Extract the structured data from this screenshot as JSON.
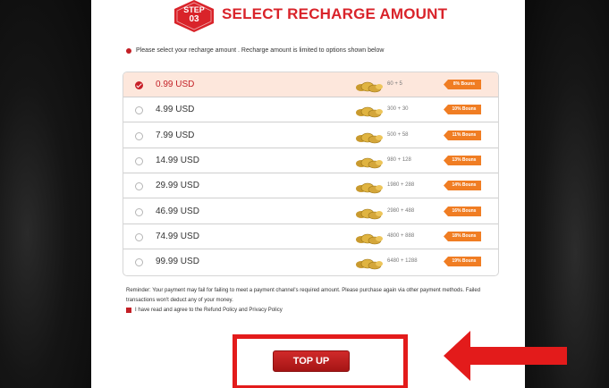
{
  "header": {
    "step_line1": "STEP",
    "step_line2": "03",
    "title": "SELECT RECHARGE AMOUNT"
  },
  "instruction": "Please select your recharge amount . Recharge amount is limited to options shown below",
  "options": [
    {
      "price": "0.99 USD",
      "amount": "60 + 5",
      "bonus": "8% Bouns",
      "selected": true
    },
    {
      "price": "4.99 USD",
      "amount": "300 + 30",
      "bonus": "10% Bouns",
      "selected": false
    },
    {
      "price": "7.99 USD",
      "amount": "500 + 58",
      "bonus": "11% Bouns",
      "selected": false
    },
    {
      "price": "14.99 USD",
      "amount": "980 + 128",
      "bonus": "13% Bouns",
      "selected": false
    },
    {
      "price": "29.99 USD",
      "amount": "1980 + 288",
      "bonus": "14% Bouns",
      "selected": false
    },
    {
      "price": "46.99 USD",
      "amount": "2980 + 488",
      "bonus": "16% Bouns",
      "selected": false
    },
    {
      "price": "74.99 USD",
      "amount": "4800 + 888",
      "bonus": "18% Bouns",
      "selected": false
    },
    {
      "price": "99.99 USD",
      "amount": "6480 + 1288",
      "bonus": "19% Bouns",
      "selected": false
    }
  ],
  "reminder": "Reminder:  Your payment may fail for failing to meet a payment channel's required amount. Please purchase again via other payment methods. Failed transactions won't deduct any of your money.",
  "agree_text": "I have read and agree to the Refund Policy and Privacy Policy",
  "topup_label": "TOP UP",
  "colors": {
    "accent": "#d9232a",
    "selected_row": "#fde7dc",
    "bonus_tag": "#f07d23",
    "arrow": "#e31b1b"
  },
  "icons": [
    "step-badge-icon",
    "coins-icon",
    "radio-icon",
    "checkbox-icon",
    "arrow-left-icon"
  ]
}
